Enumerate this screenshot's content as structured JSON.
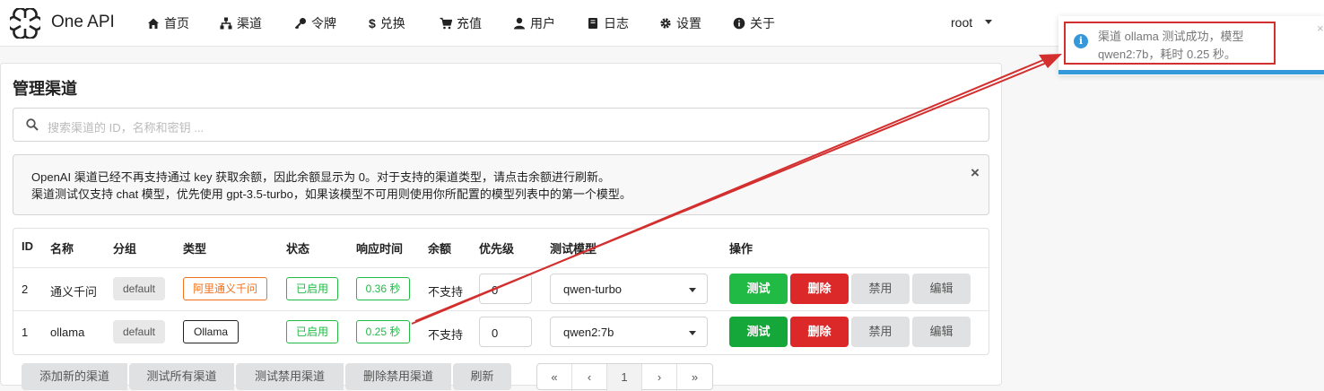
{
  "brand": "One API",
  "nav": [
    "首页",
    "渠道",
    "令牌",
    "兑换",
    "充值",
    "用户",
    "日志",
    "设置",
    "关于"
  ],
  "user": "root",
  "page_title": "管理渠道",
  "search_placeholder": "搜索渠道的 ID，名称和密钥 ...",
  "notice": {
    "line1": "OpenAI 渠道已经不再支持通过 key 获取余额，因此余额显示为 0。对于支持的渠道类型，请点击余额进行刷新。",
    "line2": "渠道测试仅支持 chat 模型，优先使用 gpt-3.5-turbo，如果该模型不可用则使用你所配置的模型列表中的第一个模型。",
    "close": "×"
  },
  "table": {
    "headers": [
      "ID",
      "名称",
      "分组",
      "类型",
      "状态",
      "响应时间",
      "余额",
      "优先级",
      "测试模型",
      "操作"
    ],
    "rows": [
      {
        "id": "2",
        "name": "通义千问",
        "group": "default",
        "type": "阿里通义千问",
        "status": "已启用",
        "time": "0.36 秒",
        "balance": "不支持",
        "priority": "0",
        "model": "qwen-turbo"
      },
      {
        "id": "1",
        "name": "ollama",
        "group": "default",
        "type": "Ollama",
        "status": "已启用",
        "time": "0.25 秒",
        "balance": "不支持",
        "priority": "0",
        "model": "qwen2:7b"
      }
    ],
    "actions": {
      "test": "测试",
      "delete": "删除",
      "disable": "禁用",
      "edit": "编辑"
    }
  },
  "bottom_buttons": [
    "添加新的渠道",
    "测试所有渠道",
    "测试禁用渠道",
    "删除禁用渠道",
    "刷新"
  ],
  "pager": [
    "«",
    "‹",
    "1",
    "›",
    "»"
  ],
  "toast": {
    "message": "渠道 ollama 测试成功，模型 qwen2:7b，耗时 0.25 秒。",
    "icon": "i",
    "close": "×"
  },
  "colors": {
    "green": "#21ba45",
    "red": "#db2828",
    "orange": "#f2711c",
    "info": "#3498db",
    "annotation": "#d32f2f"
  }
}
